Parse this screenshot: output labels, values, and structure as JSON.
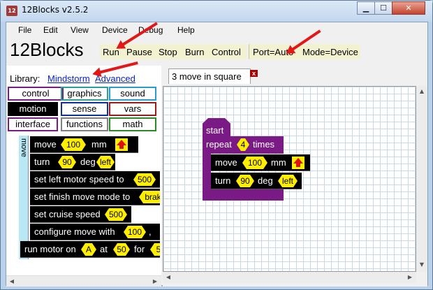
{
  "window": {
    "title": "12Blocks v2.5.2",
    "icon_text": "12",
    "minimize_icon": "minimize-icon",
    "maximize_icon": "maximize-icon",
    "close_icon": "close-icon"
  },
  "menubar": {
    "items": [
      "File",
      "Edit",
      "View",
      "Device",
      "Debug",
      "Help"
    ]
  },
  "toolbar": {
    "brand": "12Blocks",
    "run_label": "Run",
    "pause_label": "Pause",
    "stop_label": "Stop",
    "burn_label": "Burn",
    "control_label": "Control",
    "port_label": "Port=Auto",
    "mode_label": "Mode=Device"
  },
  "library": {
    "label": "Library:",
    "links": [
      "Mindstorm",
      "Advanced"
    ],
    "categories": [
      {
        "label": "control",
        "color": "#7a1a84"
      },
      {
        "label": "graphics",
        "color": "#2aa198"
      },
      {
        "label": "sound",
        "color": "#2a9bd0"
      },
      {
        "label": "motion",
        "color": "#000000"
      },
      {
        "label": "sense",
        "color": "#1030a0"
      },
      {
        "label": "vars",
        "color": "#a01a1a"
      },
      {
        "label": "interface",
        "color": "#7a1a84"
      },
      {
        "label": "functions",
        "color": "#808080"
      },
      {
        "label": "math",
        "color": "#2a8a2a"
      }
    ],
    "group_tab": "move"
  },
  "palette_blocks": {
    "move": {
      "label": "move",
      "value": "100",
      "unit": "mm"
    },
    "turn": {
      "label": "turn",
      "value": "90",
      "unit": "deg",
      "dir": "left"
    },
    "set_left": {
      "label": "set left motor speed to",
      "value": "500"
    },
    "set_finish": {
      "label": "set finish move mode to",
      "value": "brak"
    },
    "set_cruise": {
      "label": "set cruise speed",
      "value": "500"
    },
    "configure": {
      "label": "configure move with",
      "value": "100",
      "sep": ","
    },
    "run_motor": {
      "label": "run motor on",
      "port": "A",
      "at": "at",
      "value": "50",
      "for": "for",
      "value2": "5"
    }
  },
  "editor": {
    "tab_label": "3 move in square",
    "tab_close": "x",
    "program": {
      "start": "start",
      "repeat_label": "repeat",
      "repeat_count": "4",
      "repeat_suffix": "times",
      "move_label": "move",
      "move_value": "100",
      "move_unit": "mm",
      "turn_label": "turn",
      "turn_value": "90",
      "turn_unit": "deg",
      "turn_dir": "left"
    }
  },
  "colors": {
    "annotation_arrow": "#e21717",
    "value_slot": "#ffee00",
    "control_block": "#7a1a84"
  }
}
